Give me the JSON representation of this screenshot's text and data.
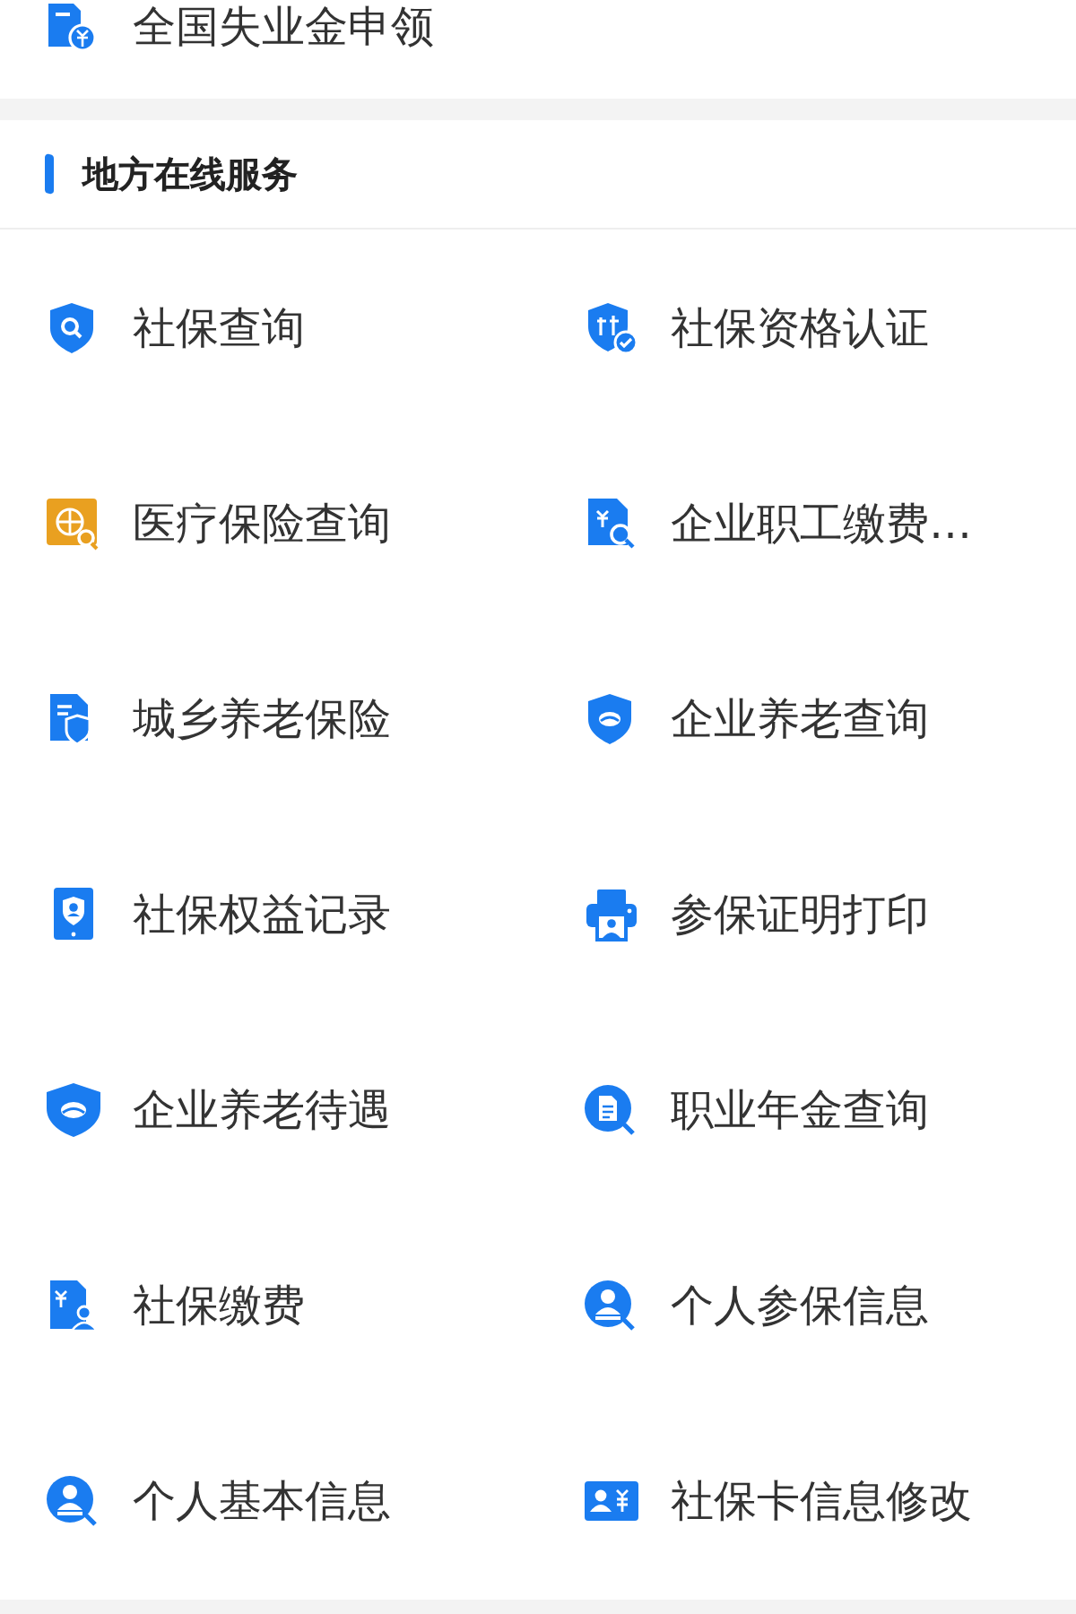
{
  "top_service": {
    "label": "全国失业金申领"
  },
  "section": {
    "title": "地方在线服务",
    "items": [
      {
        "label": "社保查询"
      },
      {
        "label": "社保资格认证"
      },
      {
        "label": "医疗保险查询"
      },
      {
        "label": "企业职工缴费…"
      },
      {
        "label": "城乡养老保险"
      },
      {
        "label": "企业养老查询"
      },
      {
        "label": "社保权益记录"
      },
      {
        "label": "参保证明打印"
      },
      {
        "label": "企业养老待遇"
      },
      {
        "label": "职业年金查询"
      },
      {
        "label": "社保缴费"
      },
      {
        "label": "个人参保信息"
      },
      {
        "label": "个人基本信息"
      },
      {
        "label": "社保卡信息修改"
      }
    ]
  }
}
